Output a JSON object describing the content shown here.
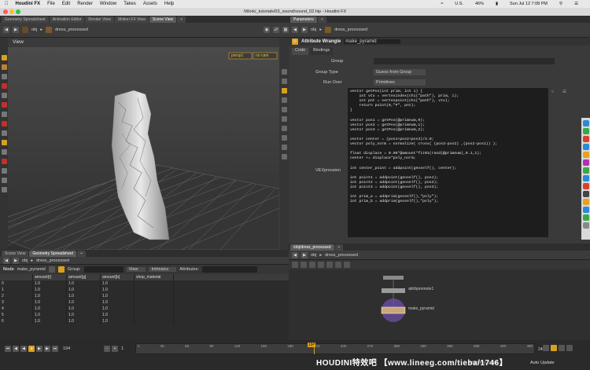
{
  "menubar": {
    "app": "Houdini FX",
    "items": [
      "File",
      "Edit",
      "Render",
      "Window",
      "Takes",
      "Assets",
      "Help"
    ],
    "status": [
      "U.S.",
      "46%",
      "Sun Jul 12  7:08 PM"
    ]
  },
  "window": {
    "title": "/Work/_tutorials/03_sound/sound_02.hip - Houdini FX"
  },
  "left_tabs": [
    "Geometry Spreadsheet",
    "Animation Editor",
    "Render View",
    "Motion FX View",
    "Scene View"
  ],
  "left_path": {
    "context": "obj",
    "node": "dress_processed"
  },
  "viewport": {
    "title": "View",
    "camera_badge": "persp1",
    "display_badge": "no cam"
  },
  "right_tabs": [
    "Parameters"
  ],
  "right_path": {
    "context": "obj",
    "node": "dress_processed"
  },
  "wrangle": {
    "node_type": "Attribute Wrangle",
    "node_name": "make_pyramid",
    "tabs": [
      "Code",
      "Bindings"
    ],
    "group_label": "Group",
    "group_type_label": "Group Type",
    "group_type_value": "Guess from Group",
    "run_over_label": "Run Over",
    "run_over_value": "Primitives",
    "vex_label": "VEXpression",
    "code": "vector getPos(int prim; int i) {\n    int vtx = vertexindex(chi(\"path\"), prim, i);\n    int pnt = vertexpoint(chi(\"path\"), vtx);\n    return point(0,\"P\", pnt);\n}\n\nvector pos1 = getPos(@primnum,0);\nvector pos2 = getPos(@primnum,1);\nvector pos3 = getPos(@primnum,2);\n\nvector center = (pos1+pos2+pos3)/3.0;\nvector poly_norm = normalize( cross( (pos3-pos2) ,(pos2-pos1)) );\n\nfloat displace = 0.06*@amount*fit01(rand(@primnum),0.1,1);\ncenter += displace*poly_norm;\n\nint center_point = addpoint(geoself(), center);\n\nint point1 = addpoint(geoself(), pos1);\nint point2 = addpoint(geoself(), pos2);\nint point3 = addpoint(geoself(), pos3);\n\nint prim_a = addprim(geoself(),\"poly\");\nint prim_b = addprim(geoself(),\"poly\");"
  },
  "network": {
    "tabs": [
      "/obj/dress_processed"
    ],
    "context": "obj",
    "node": "dress_processed",
    "nodes": [
      {
        "name": "attribpromote1"
      },
      {
        "name": "make_pyramid"
      }
    ]
  },
  "sheet": {
    "tabs": [
      "Scene View",
      "Geometry Spreadsheet"
    ],
    "context": "obj",
    "node": "dress_processed",
    "node_label": "Node",
    "node_value": "make_pyramid",
    "group_label": "Group:",
    "view_label": "View",
    "intrinsics_label": "Intrinsics",
    "attributes_label": "Attributes:",
    "columns": [
      "",
      "amount[r]",
      "amount[g]",
      "amount[b]",
      "shop_material"
    ],
    "rows": [
      [
        "0",
        "1.0",
        "1.0",
        "1.0",
        ""
      ],
      [
        "1",
        "1.0",
        "1.0",
        "1.0",
        ""
      ],
      [
        "2",
        "1.0",
        "1.0",
        "1.0",
        ""
      ],
      [
        "3",
        "1.0",
        "1.0",
        "1.0",
        ""
      ],
      [
        "4",
        "1.0",
        "1.0",
        "1.0",
        ""
      ],
      [
        "5",
        "1.0",
        "1.0",
        "1.0",
        ""
      ],
      [
        "6",
        "1.0",
        "1.0",
        "1.0",
        ""
      ]
    ]
  },
  "timeline": {
    "current_frame": "194",
    "start_frame": "1",
    "end_label": "240",
    "ticks": [
      "1",
      "30",
      "60",
      "90",
      "120",
      "150",
      "180",
      "210",
      "240",
      "270",
      "300",
      "330",
      "360",
      "390",
      "420",
      "450"
    ],
    "frame_marker": "194",
    "auto_update": "Auto Update",
    "path_label": "/obj/dress_proce..."
  },
  "watermark": "HOUDINI特效吧  【www.lineeg.com/tieba/1746】"
}
